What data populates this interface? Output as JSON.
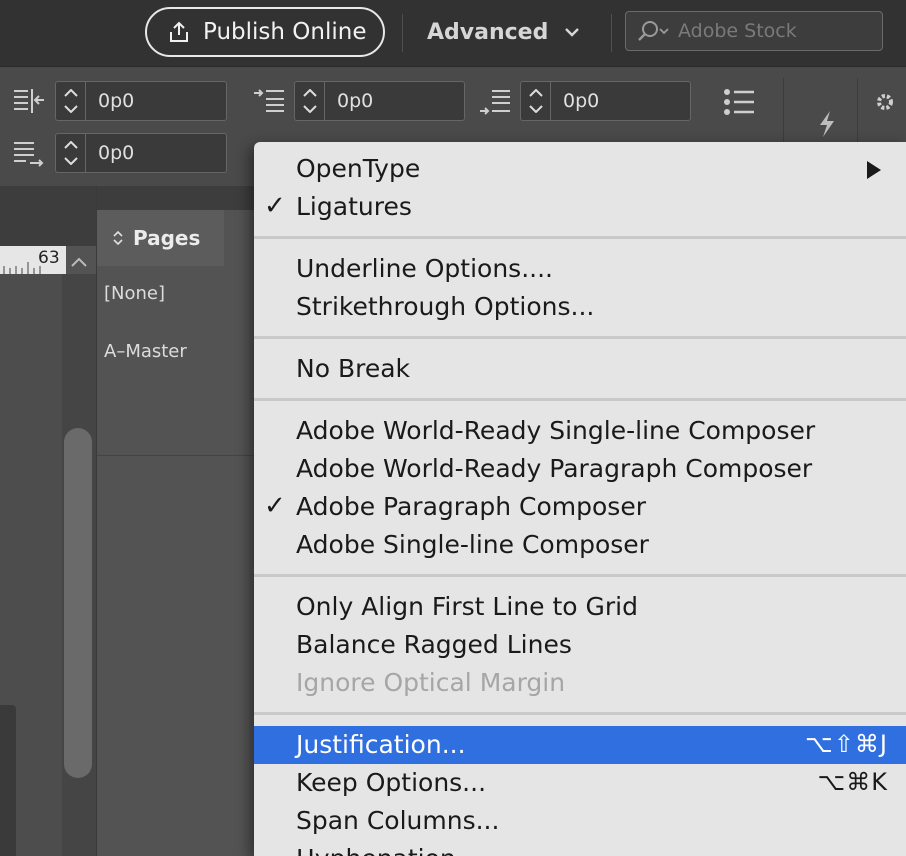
{
  "header": {
    "publish_label": "Publish Online",
    "workspace_label": "Advanced",
    "search_placeholder": "Adobe Stock"
  },
  "control_bar": {
    "fields": [
      {
        "value": "0p0"
      },
      {
        "value": "0p0"
      },
      {
        "value": "0p0"
      },
      {
        "value": "0p0"
      }
    ]
  },
  "pages_panel": {
    "title": "Pages",
    "items": [
      "[None]",
      "A–Master"
    ]
  },
  "ruler": {
    "number": "63"
  },
  "menu": {
    "items": [
      {
        "label": "OpenType",
        "submenu": true
      },
      {
        "label": "Ligatures",
        "checked": true
      },
      {
        "label": "Underline Options...."
      },
      {
        "label": "Strikethrough Options..."
      },
      {
        "label": "No Break"
      },
      {
        "label": "Adobe World-Ready Single-line Composer"
      },
      {
        "label": "Adobe World-Ready Paragraph Composer"
      },
      {
        "label": "Adobe Paragraph Composer",
        "checked": true
      },
      {
        "label": "Adobe Single-line Composer"
      },
      {
        "label": "Only Align First Line to Grid"
      },
      {
        "label": "Balance Ragged Lines"
      },
      {
        "label": "Ignore Optical Margin",
        "disabled": true
      },
      {
        "label": "Justification...",
        "shortcut": "⌥⇧⌘J",
        "highlighted": true
      },
      {
        "label": "Keep Options...",
        "shortcut": "⌥⌘K"
      },
      {
        "label": "Span Columns..."
      },
      {
        "label": "Hyphenation..."
      }
    ],
    "check_glyph": "✓"
  },
  "colors": {
    "menu_highlight": "#2f6fe0",
    "menu_background": "#e5e5e5",
    "app_dark": "#323232"
  }
}
